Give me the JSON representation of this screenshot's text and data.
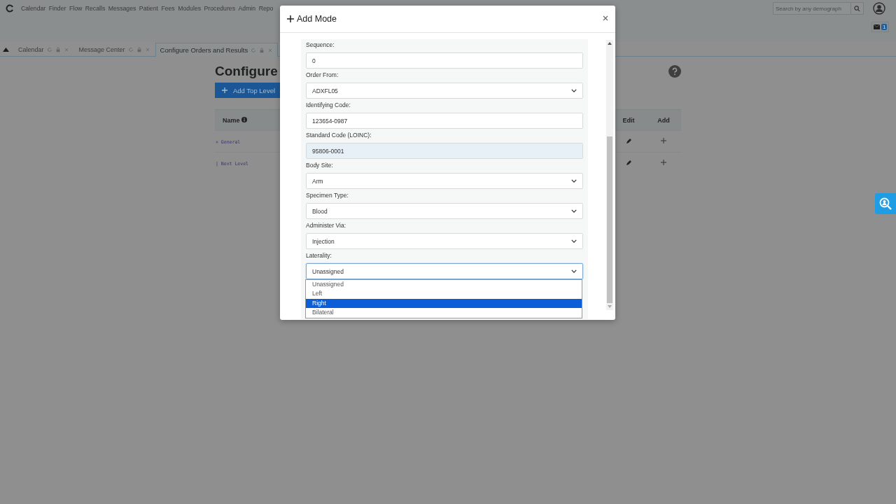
{
  "nav": {
    "items": [
      "Calendar",
      "Finder",
      "Flow",
      "Recalls",
      "Messages",
      "Patient",
      "Fees",
      "Modules",
      "Procedures",
      "Admin",
      "Repo"
    ],
    "search": {
      "placeholder": "Search by any demograph"
    },
    "mail_count": "1"
  },
  "tabs": [
    {
      "label": "Calendar",
      "selected": false
    },
    {
      "label": "Message Center",
      "selected": false
    },
    {
      "label": "Configure Orders and Results",
      "selected": true
    }
  ],
  "page": {
    "title": "Configure",
    "add_button": "Add Top Level",
    "table": {
      "columns": [
        "Name",
        "Edit",
        "Add"
      ],
      "rows": [
        {
          "name": "+ General"
        },
        {
          "name": "| Next Level"
        }
      ]
    }
  },
  "modal": {
    "title": "Add Mode",
    "fields": [
      {
        "label": "Sequence:",
        "kind": "text",
        "value": "0",
        "readonly": false,
        "focused": false
      },
      {
        "label": "Order From:",
        "kind": "select",
        "value": "ADXFL05",
        "readonly": false,
        "focused": false
      },
      {
        "label": "Identifying Code:",
        "kind": "text",
        "value": "123654-0987",
        "readonly": false,
        "focused": false
      },
      {
        "label": "Standard Code (LOINC):",
        "kind": "text",
        "value": "95806-0001",
        "readonly": true,
        "focused": false
      },
      {
        "label": "Body Site:",
        "kind": "select",
        "value": "Arm",
        "readonly": false,
        "focused": false
      },
      {
        "label": "Specimen Type:",
        "kind": "select",
        "value": "Blood",
        "readonly": false,
        "focused": false
      },
      {
        "label": "Administer Via:",
        "kind": "select",
        "value": "Injection",
        "readonly": false,
        "focused": false
      },
      {
        "label": "Laterality:",
        "kind": "select",
        "value": "Unassigned",
        "readonly": false,
        "focused": true
      }
    ],
    "dropdown": {
      "options": [
        {
          "label": "Unassigned",
          "selected": false
        },
        {
          "label": "Left",
          "selected": false
        },
        {
          "label": "Right",
          "selected": true
        },
        {
          "label": "Bilateral",
          "selected": false
        }
      ]
    }
  }
}
